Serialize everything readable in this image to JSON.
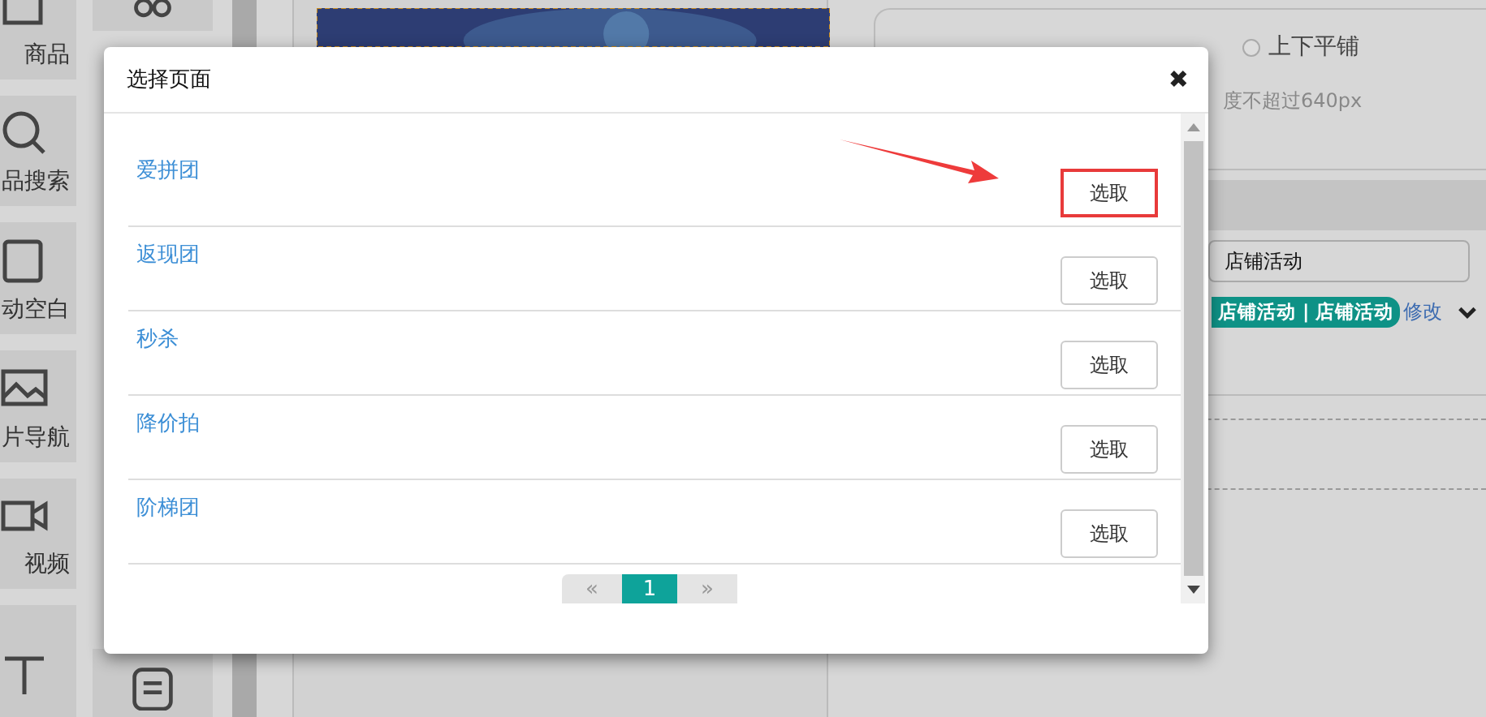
{
  "sidebar": {
    "tiles": [
      {
        "label": "商品"
      },
      {
        "label": "品搜索"
      },
      {
        "label": "动空白"
      },
      {
        "label": "片导航"
      },
      {
        "label": "视频"
      }
    ]
  },
  "settings": {
    "radio": {
      "label": "上下平铺",
      "checked": false
    },
    "hint": "度不超过640px",
    "link_field": {
      "value": "店铺活动"
    },
    "tag": "店铺活动 | 店铺活动",
    "edit_link": "修改"
  },
  "dialog": {
    "title": "选择页面",
    "close": "✖",
    "items": [
      {
        "label": "爱拼团",
        "button": "选取",
        "highlighted": true
      },
      {
        "label": "返现团",
        "button": "选取",
        "highlighted": false
      },
      {
        "label": "秒杀",
        "button": "选取",
        "highlighted": false
      },
      {
        "label": "降价拍",
        "button": "选取",
        "highlighted": false
      },
      {
        "label": "阶梯团",
        "button": "选取",
        "highlighted": false
      }
    ],
    "pagination": {
      "prev": "«",
      "pages": [
        {
          "label": "1",
          "selected": true
        }
      ],
      "next": "»"
    }
  }
}
